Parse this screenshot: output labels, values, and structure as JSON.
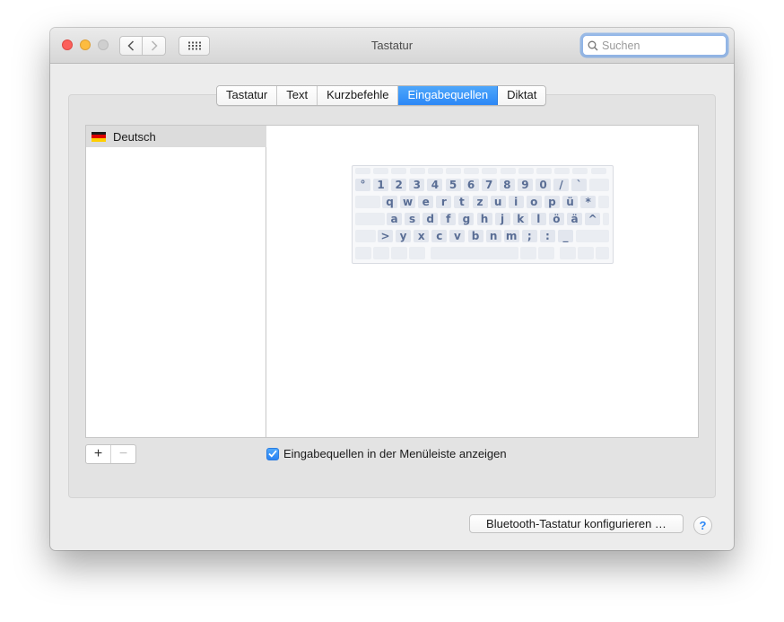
{
  "window": {
    "title": "Tastatur",
    "search_placeholder": "Suchen"
  },
  "tabs": [
    {
      "label": "Tastatur",
      "active": false
    },
    {
      "label": "Text",
      "active": false
    },
    {
      "label": "Kurzbefehle",
      "active": false
    },
    {
      "label": "Eingabequellen",
      "active": true
    },
    {
      "label": "Diktat",
      "active": false
    }
  ],
  "sources": {
    "items": [
      {
        "label": "Deutsch",
        "flag": "german-flag-icon",
        "selected": true
      }
    ],
    "add_label": "+",
    "remove_label": "−"
  },
  "keyboard_preview": {
    "rows": [
      [
        "°",
        "1",
        "2",
        "3",
        "4",
        "5",
        "6",
        "7",
        "8",
        "9",
        "0",
        "/",
        "`"
      ],
      [
        "q",
        "w",
        "e",
        "r",
        "t",
        "z",
        "u",
        "i",
        "o",
        "p",
        "ü",
        "*"
      ],
      [
        "a",
        "s",
        "d",
        "f",
        "g",
        "h",
        "j",
        "k",
        "l",
        "ö",
        "ä",
        "^"
      ],
      [
        ">",
        "y",
        "x",
        "c",
        "v",
        "b",
        "n",
        "m",
        ";",
        ":",
        "_"
      ]
    ]
  },
  "show_in_menubar": {
    "label": "Eingabequellen in der Menüleiste anzeigen",
    "checked": true
  },
  "footer": {
    "bluetooth_label": "Bluetooth-Tastatur konfigurieren …",
    "help_label": "?"
  },
  "colors": {
    "accent": "#2b87f6",
    "close": "#fc605b",
    "minimize": "#fdbc40",
    "zoom_disabled": "#cfcfcf"
  }
}
